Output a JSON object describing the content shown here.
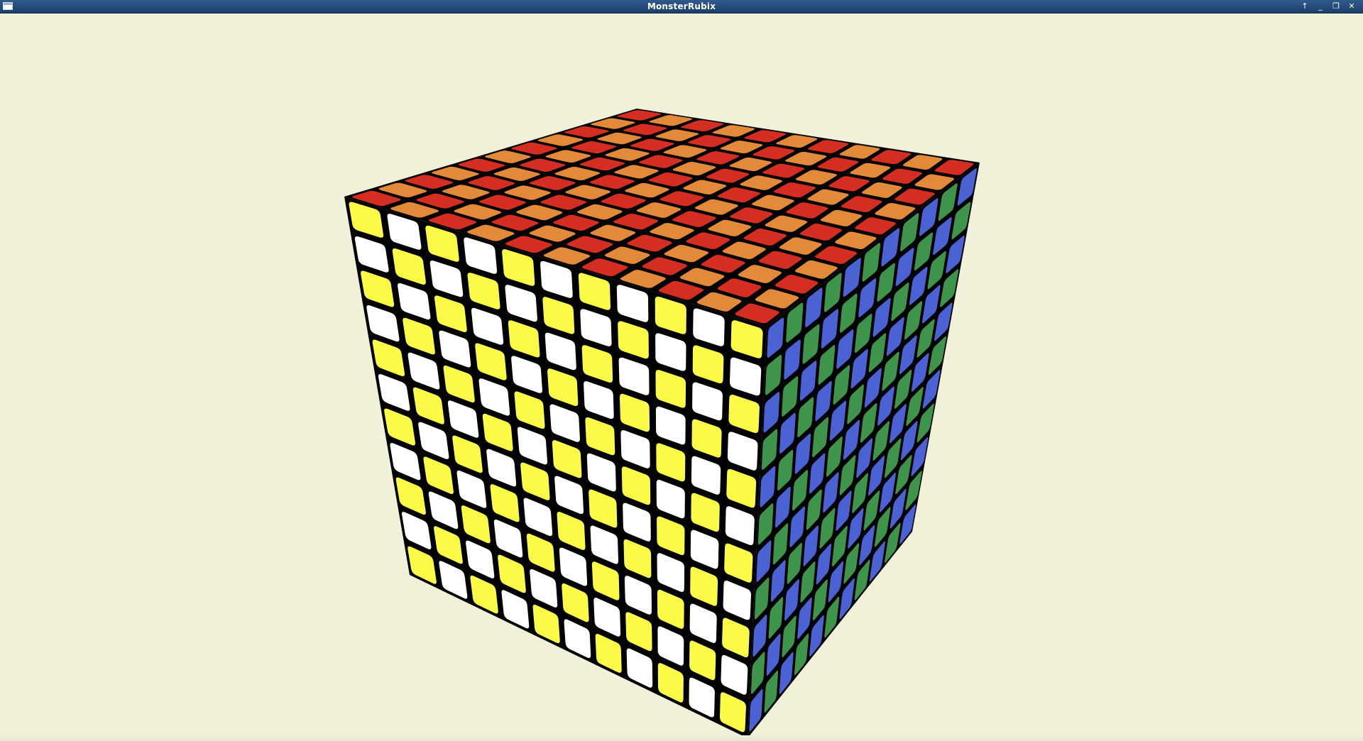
{
  "window": {
    "title": "MonsterRubix",
    "background_color": "#f1f1da",
    "titlebar_color": "#2a5286",
    "controls": [
      {
        "name": "roll-up",
        "icon": "arrow-up-icon",
        "glyph": "↑"
      },
      {
        "name": "minimize",
        "icon": "minimize-icon",
        "glyph": "_"
      },
      {
        "name": "maximize",
        "icon": "restore-icon",
        "glyph": "❐"
      },
      {
        "name": "close",
        "icon": "close-icon",
        "glyph": "✕"
      }
    ]
  },
  "cube": {
    "size": 11,
    "faces": {
      "top": {
        "colors": [
          "red",
          "orange"
        ],
        "pattern": "checkerboard"
      },
      "front": {
        "colors": [
          "yellow",
          "white"
        ],
        "pattern": "checkerboard"
      },
      "right": {
        "colors": [
          "blue",
          "green"
        ],
        "pattern": "checkerboard"
      }
    },
    "palette": {
      "red": "#d42d22",
      "orange": "#e28a3a",
      "yellow": "#fbfb47",
      "white": "#ffffff",
      "blue": "#4a62d3",
      "green": "#3f944c",
      "gap": "#000000"
    }
  }
}
